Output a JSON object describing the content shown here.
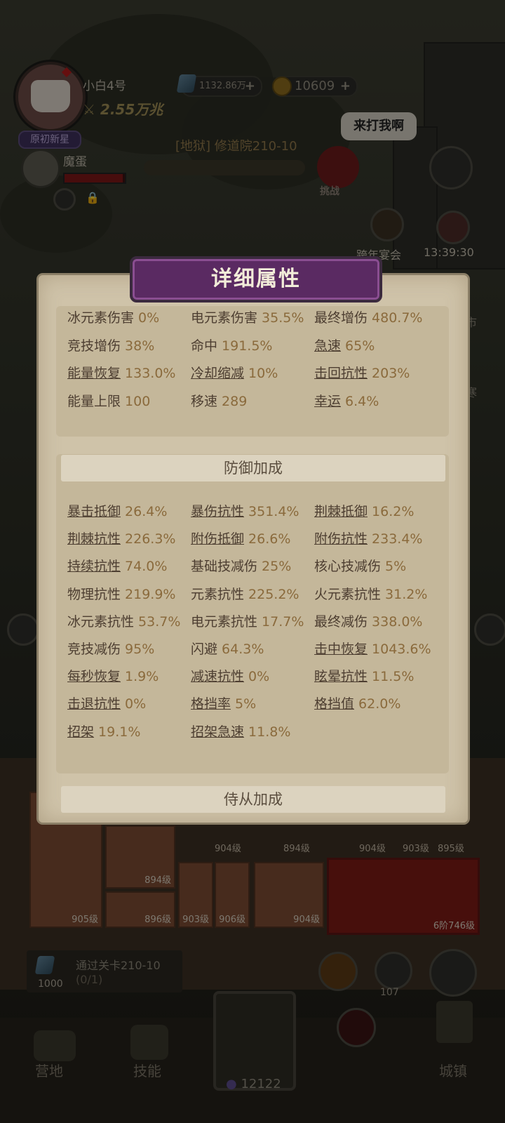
{
  "player": {
    "name": "小白4号",
    "power": "2.55万兆",
    "rank": "原初新星"
  },
  "resources": {
    "gems": "1132.86万",
    "coins": "10609"
  },
  "pet": {
    "name": "魔蛋",
    "hp_fraction": 0.96
  },
  "stage": {
    "label": "[地狱] 修道院210-10",
    "bubble": "来打我啊",
    "challenge": "挑战"
  },
  "events": [
    {
      "label": "跨年宴会"
    },
    {
      "label": "13:39:30"
    }
  ],
  "side_labels": [
    "市",
    "寒"
  ],
  "bottom": {
    "slot_levels": [
      "905级",
      "894级",
      "896级",
      "903级",
      "906级",
      "904级",
      "6阶746级"
    ],
    "top_levels": [
      "904级",
      "894级",
      "904级",
      "903级",
      "895级"
    ],
    "quest": {
      "text": "通过关卡210-10",
      "progress": "(0/1)",
      "reward": "1000"
    },
    "counter_107": "107",
    "nav": {
      "camp": "营地",
      "skills": "技能",
      "center_value": "12122",
      "town": "城镇"
    }
  },
  "dialog": {
    "title": "详细属性",
    "top_stats": [
      {
        "label": "冰元素伤害",
        "value": "0%",
        "underline": false
      },
      {
        "label": "电元素伤害",
        "value": "35.5%",
        "underline": false
      },
      {
        "label": "最终增伤",
        "value": "480.7%",
        "underline": false
      },
      {
        "label": "竞技增伤",
        "value": "38%",
        "underline": false
      },
      {
        "label": "命中",
        "value": "191.5%",
        "underline": false
      },
      {
        "label": "急速",
        "value": "65%",
        "underline": true
      },
      {
        "label": "能量恢复",
        "value": "133.0%",
        "underline": true
      },
      {
        "label": "冷却缩减",
        "value": "10%",
        "underline": true
      },
      {
        "label": "击回抗性",
        "value": "203%",
        "underline": true
      },
      {
        "label": "能量上限",
        "value": "100",
        "underline": false
      },
      {
        "label": "移速",
        "value": "289",
        "underline": false
      },
      {
        "label": "幸运",
        "value": "6.4%",
        "underline": true
      }
    ],
    "defense_title": "防御加成",
    "defense_stats": [
      {
        "label": "暴击抵御",
        "value": "26.4%",
        "underline": true
      },
      {
        "label": "暴伤抗性",
        "value": "351.4%",
        "underline": true
      },
      {
        "label": "荆棘抵御",
        "value": "16.2%",
        "underline": true
      },
      {
        "label": "荆棘抗性",
        "value": "226.3%",
        "underline": true
      },
      {
        "label": "附伤抵御",
        "value": "26.6%",
        "underline": true
      },
      {
        "label": "附伤抗性",
        "value": "233.4%",
        "underline": true
      },
      {
        "label": "持续抗性",
        "value": "74.0%",
        "underline": true
      },
      {
        "label": "基础技减伤",
        "value": "25%",
        "underline": false
      },
      {
        "label": "核心技减伤",
        "value": "5%",
        "underline": false
      },
      {
        "label": "物理抗性",
        "value": "219.9%",
        "underline": false
      },
      {
        "label": "元素抗性",
        "value": "225.2%",
        "underline": false
      },
      {
        "label": "火元素抗性",
        "value": "31.2%",
        "underline": false
      },
      {
        "label": "冰元素抗性",
        "value": "53.7%",
        "underline": false
      },
      {
        "label": "电元素抗性",
        "value": "17.7%",
        "underline": false
      },
      {
        "label": "最终减伤",
        "value": "338.0%",
        "underline": false
      },
      {
        "label": "竞技减伤",
        "value": "95%",
        "underline": false
      },
      {
        "label": "闪避",
        "value": "64.3%",
        "underline": false
      },
      {
        "label": "击中恢复",
        "value": "1043.6%",
        "underline": true
      },
      {
        "label": "每秒恢复",
        "value": "1.9%",
        "underline": true
      },
      {
        "label": "减速抗性",
        "value": "0%",
        "underline": true
      },
      {
        "label": "眩晕抗性",
        "value": "11.5%",
        "underline": true
      },
      {
        "label": "击退抗性",
        "value": "0%",
        "underline": true
      },
      {
        "label": "格挡率",
        "value": "5%",
        "underline": true
      },
      {
        "label": "格挡值",
        "value": "62.0%",
        "underline": true
      },
      {
        "label": "招架",
        "value": "19.1%",
        "underline": true
      },
      {
        "label": "招架急速",
        "value": "11.8%",
        "underline": true
      }
    ],
    "follower_title": "侍从加成"
  }
}
